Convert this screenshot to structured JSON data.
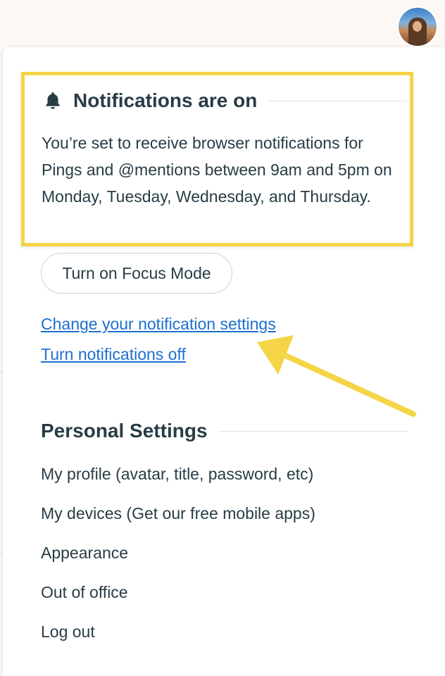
{
  "notifications": {
    "heading": "Notifications are on",
    "icon": "bell-icon",
    "description": "You’re set to receive browser notifications for Pings and @mentions between 9am and 5pm on Monday, Tuesday, Wednesday, and Thursday.",
    "focus_button_label": "Turn on Focus Mode",
    "change_settings_link": "Change your notification settings",
    "turn_off_link": "Turn notifications off"
  },
  "personal_settings": {
    "heading": "Personal Settings",
    "items": [
      {
        "label": "My profile (avatar, title, password, etc)"
      },
      {
        "label": "My devices (Get our free mobile apps)"
      },
      {
        "label": "Appearance"
      },
      {
        "label": "Out of office"
      },
      {
        "label": "Log out"
      }
    ]
  },
  "colors": {
    "highlight_border": "#f5d547",
    "annotation_arrow": "#f5d547",
    "link": "#1d6fd0",
    "text": "#283c46"
  }
}
